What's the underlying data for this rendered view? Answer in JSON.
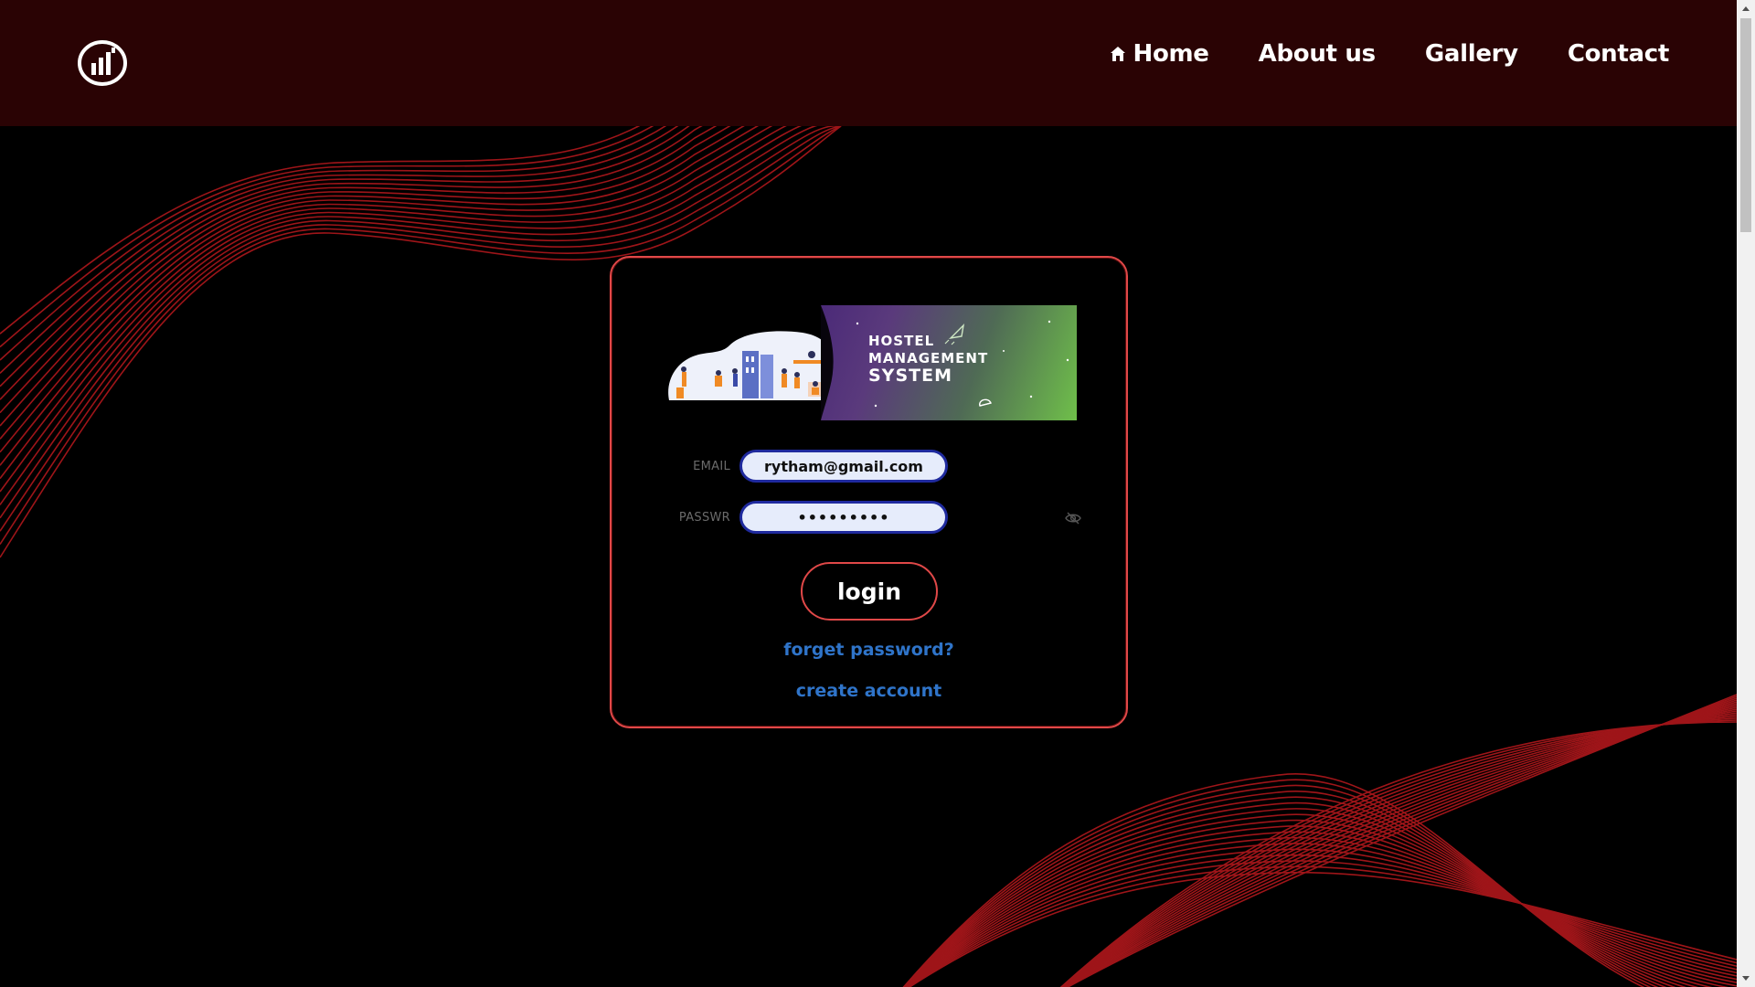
{
  "header": {
    "logo_icon": "signal-chart-logo-icon",
    "nav": [
      {
        "label": "Home",
        "icon": "home-icon"
      },
      {
        "label": "About us"
      },
      {
        "label": "Gallery"
      },
      {
        "label": "Contact"
      }
    ]
  },
  "banner": {
    "line1": "HOSTEL",
    "line2": "MANAGEMENT",
    "line3": "SYSTEM"
  },
  "form": {
    "email_label": "EMAIL",
    "email_value": "rytham@gmail.com",
    "password_label": "PASSWR",
    "password_value": "•••••••••",
    "password_toggle_icon": "eye-slash-icon",
    "login_label": "login",
    "forgot_label": "forget password?",
    "create_label": "create account"
  },
  "colors": {
    "header_bg": "#2a0304",
    "accent_red": "#e04848",
    "link_blue": "#2f74c9",
    "input_border": "#1f2a9e"
  }
}
